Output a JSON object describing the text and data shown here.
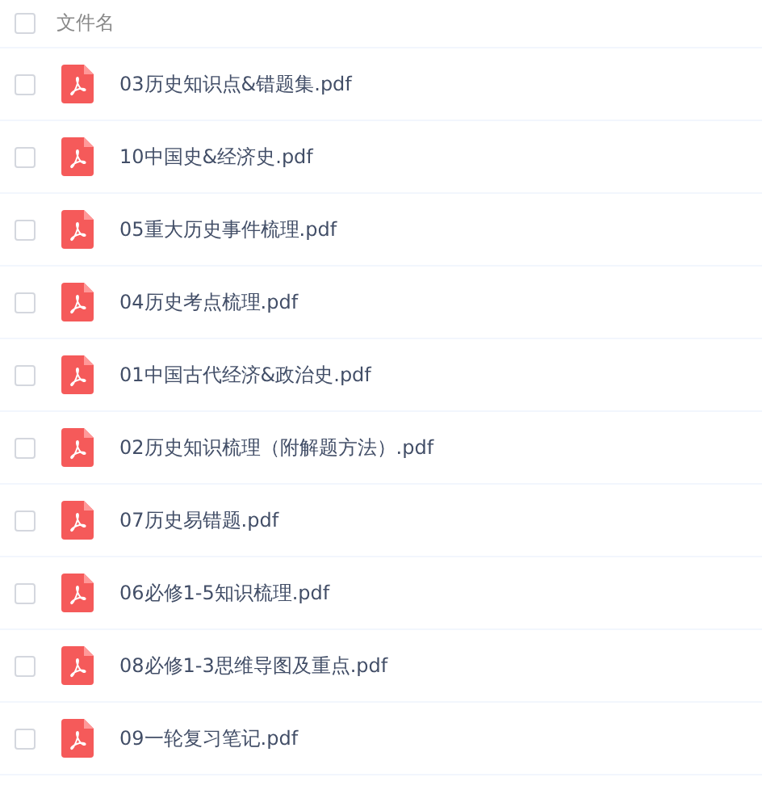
{
  "header": {
    "label": "文件名",
    "checked": false
  },
  "files": [
    {
      "name": "03历史知识点&错题集.pdf",
      "checked": false
    },
    {
      "name": "10中国史&经济史.pdf",
      "checked": false
    },
    {
      "name": "05重大历史事件梳理.pdf",
      "checked": false
    },
    {
      "name": "04历史考点梳理.pdf",
      "checked": false
    },
    {
      "name": "01中国古代经济&政治史.pdf",
      "checked": false
    },
    {
      "name": "02历史知识梳理（附解题方法）.pdf",
      "checked": false
    },
    {
      "name": "07历史易错题.pdf",
      "checked": false
    },
    {
      "name": "06必修1-5知识梳理.pdf",
      "checked": false
    },
    {
      "name": "08必修1-3思维导图及重点.pdf",
      "checked": false
    },
    {
      "name": "09一轮复习笔记.pdf",
      "checked": false
    }
  ]
}
